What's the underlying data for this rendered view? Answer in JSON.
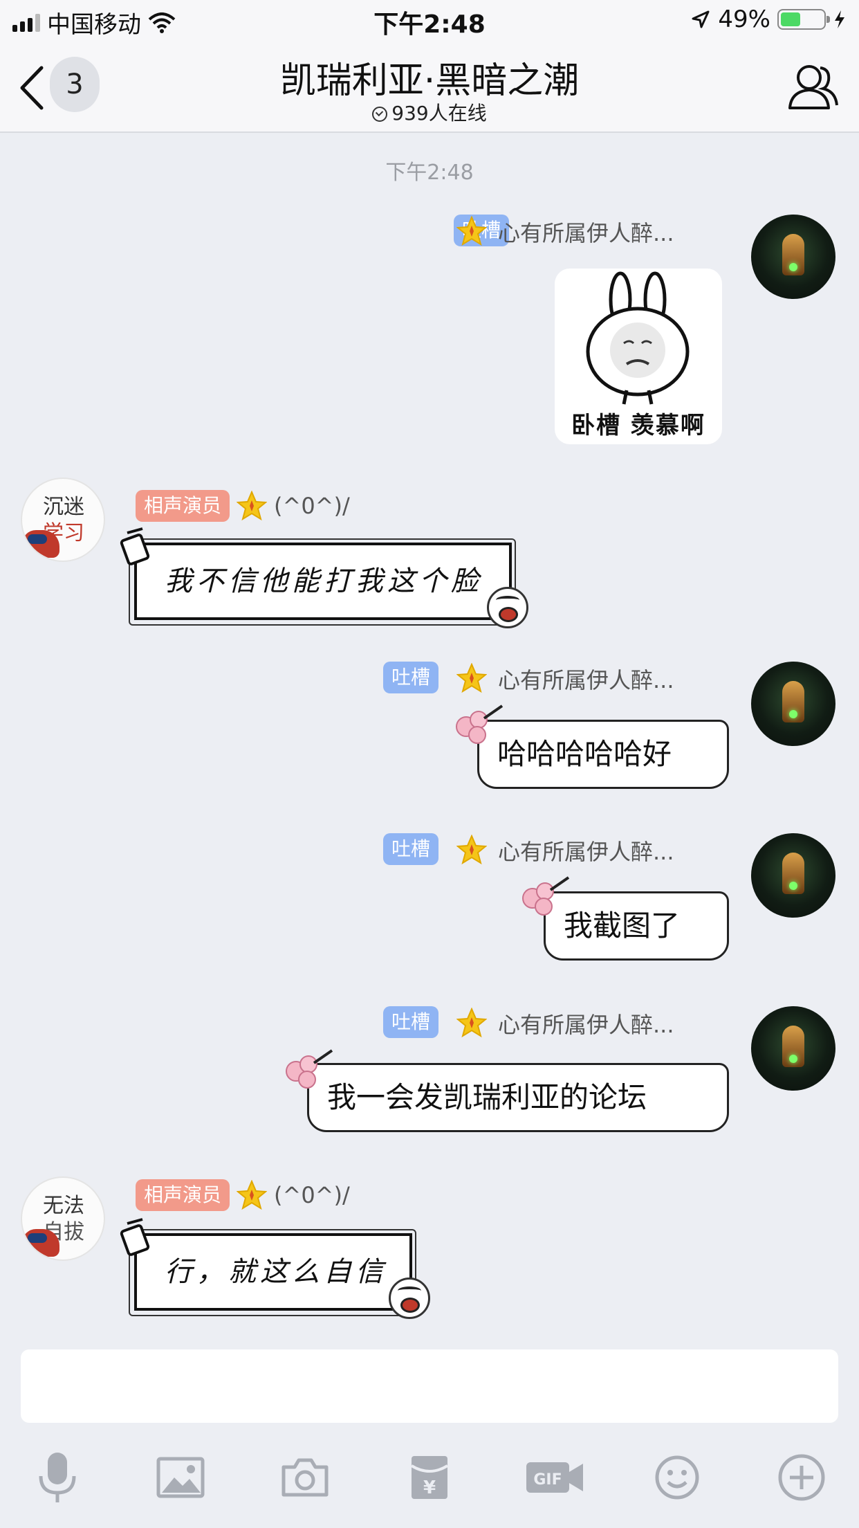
{
  "status_bar": {
    "carrier": "中国移动",
    "time": "下午2:48",
    "battery_percent": "49%",
    "battery_level": 0.49
  },
  "header": {
    "back_badge": "3",
    "title": "凯瑞利亚·黑暗之潮",
    "online": "939人在线"
  },
  "chat": {
    "timestamp": "下午2:48",
    "messages": [
      {
        "side": "right",
        "tag": "吐槽",
        "name": "心有所属伊人醉...",
        "type": "sticker",
        "sticker_text": "卧槽 羡慕啊"
      },
      {
        "side": "left",
        "tag": "相声演员",
        "name": "(^0^)/",
        "avatar_text": [
          "沉迷",
          "学习"
        ],
        "text": "我不信他能打我这个脸"
      },
      {
        "side": "right",
        "tag": "吐槽",
        "name": "心有所属伊人醉...",
        "text": "哈哈哈哈哈好"
      },
      {
        "side": "right",
        "tag": "吐槽",
        "name": "心有所属伊人醉...",
        "text": "我截图了"
      },
      {
        "side": "right",
        "tag": "吐槽",
        "name": "心有所属伊人醉...",
        "text": "我一会发凯瑞利亚的论坛"
      },
      {
        "side": "left",
        "tag": "相声演员",
        "name": "(^0^)/",
        "avatar_text": [
          "无法",
          "自拔"
        ],
        "text": "行，就这么自信"
      }
    ]
  },
  "input": {
    "value": ""
  },
  "toolbar": {
    "icons": [
      "microphone-icon",
      "image-icon",
      "camera-icon",
      "red-packet-icon",
      "gif-icon",
      "emoji-icon",
      "plus-icon"
    ],
    "gif_label": "GIF",
    "red_packet_symbol": "¥"
  },
  "colors": {
    "tag_blue": "#8fb4f3",
    "tag_red": "#f29a8a",
    "background": "#eceef3"
  }
}
